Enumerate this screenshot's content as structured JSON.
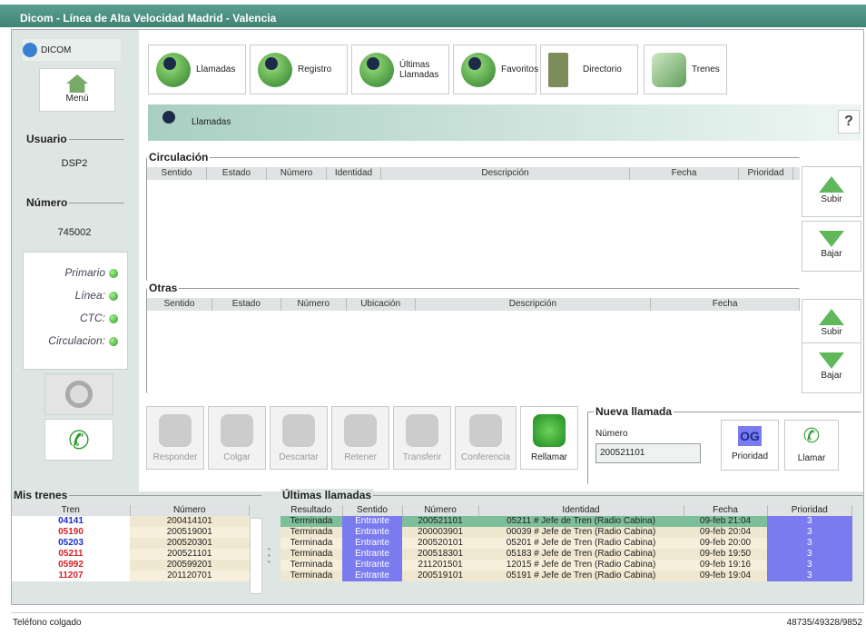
{
  "window": {
    "title": "Dicom - Línea de Alta Velocidad Madrid - Valencia"
  },
  "sidebar": {
    "app_label": "DICOM",
    "menu_label": "Menú",
    "usuario_legend": "Usuario",
    "usuario_value": "DSP2",
    "numero_legend": "Número",
    "numero_value": "745002",
    "status": [
      {
        "label": "Primario"
      },
      {
        "label": "Línea:"
      },
      {
        "label": "CTC:"
      },
      {
        "label": "Circulacion:"
      }
    ]
  },
  "toolbar": {
    "items": [
      {
        "label": "Llamadas"
      },
      {
        "label": "Registro"
      },
      {
        "label": "Últimas Llamadas"
      },
      {
        "label": "Favoritos"
      },
      {
        "label": "Directorio"
      },
      {
        "label": "Trenes"
      }
    ]
  },
  "section": {
    "title": "Llamadas",
    "help": "?"
  },
  "circulacion": {
    "legend": "Circulación",
    "columns": [
      "Sentido",
      "Estado",
      "Número",
      "Identidad",
      "Descripción",
      "Fecha",
      "Prioridad"
    ]
  },
  "otras": {
    "legend": "Otras",
    "columns": [
      "Sentido",
      "Estado",
      "Número",
      "Ubicación",
      "Descripción",
      "Fecha"
    ]
  },
  "arrows": {
    "subir": "Subir",
    "bajar": "Bajar"
  },
  "call_buttons": [
    {
      "label": "Responder"
    },
    {
      "label": "Colgar"
    },
    {
      "label": "Descartar"
    },
    {
      "label": "Retener"
    },
    {
      "label": "Transferir"
    },
    {
      "label": "Conferencia"
    },
    {
      "label": "Rellamar"
    }
  ],
  "nueva": {
    "legend": "Nueva llamada",
    "numero_label": "Número",
    "numero_value": "200521101",
    "og": "OG",
    "prioridad": "Prioridad",
    "llamar": "Llamar"
  },
  "mis_trenes": {
    "legend": "Mis trenes",
    "columns": [
      "Tren",
      "Número"
    ],
    "rows": [
      [
        "04141",
        "200414101"
      ],
      [
        "05190",
        "200519001"
      ],
      [
        "05203",
        "200520301"
      ],
      [
        "05211",
        "200521101"
      ],
      [
        "05992",
        "200599201"
      ],
      [
        "11207",
        "201120701"
      ]
    ]
  },
  "ultimas": {
    "legend": "Últimas llamadas",
    "columns": [
      "Resultado",
      "Sentido",
      "Número",
      "Identidad",
      "Fecha",
      "Prioridad"
    ],
    "rows": [
      [
        "Terminada",
        "Entrante",
        "200521101",
        "05211 # Jefe de Tren (Radio Cabina)",
        "09-feb 21:04",
        "3"
      ],
      [
        "Terminada",
        "Entrante",
        "200003901",
        "00039 # Jefe de Tren (Radio Cabina)",
        "09-feb 20:04",
        "3"
      ],
      [
        "Terminada",
        "Entrante",
        "200520101",
        "05201 # Jefe de Tren (Radio Cabina)",
        "09-feb 20:00",
        "3"
      ],
      [
        "Terminada",
        "Entrante",
        "200518301",
        "05183 # Jefe de Tren (Radio Cabina)",
        "09-feb 19:50",
        "3"
      ],
      [
        "Terminada",
        "Entrante",
        "211201501",
        "12015 # Jefe de Tren (Radio Cabina)",
        "09-feb 19:16",
        "3"
      ],
      [
        "Terminada",
        "Entrante",
        "200519101",
        "05191 # Jefe de Tren (Radio Cabina)",
        "09-feb 19:04",
        "3"
      ]
    ]
  },
  "status": {
    "left": "Teléfono colgado",
    "right": "48735/49328/9852"
  },
  "colors": {
    "title": "#4a8f7f",
    "tren_red": "#d4202a",
    "tren_blue": "#1a2ecf",
    "entrante": "#7b7bf0",
    "selected": "#7dbf9a"
  }
}
